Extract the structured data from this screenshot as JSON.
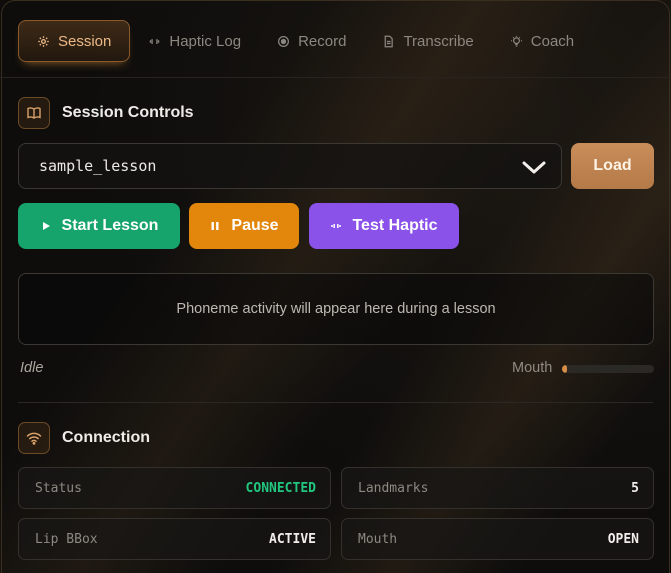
{
  "tabs": [
    {
      "label": "Session",
      "icon": "gear-icon",
      "active": true
    },
    {
      "label": "Haptic Log",
      "icon": "vibration-icon",
      "active": false
    },
    {
      "label": "Record",
      "icon": "record-icon",
      "active": false
    },
    {
      "label": "Transcribe",
      "icon": "document-icon",
      "active": false
    },
    {
      "label": "Coach",
      "icon": "lightbulb-icon",
      "active": false
    }
  ],
  "session_controls": {
    "title": "Session Controls",
    "icon": "book-icon",
    "lesson_select": {
      "value": "sample_lesson"
    },
    "load_label": "Load",
    "start_label": "Start Lesson",
    "pause_label": "Pause",
    "test_haptic_label": "Test Haptic",
    "phoneme_placeholder": "Phoneme activity will appear here during a lesson",
    "status_text": "Idle",
    "mouth_label": "Mouth",
    "mouth_level": 0.05
  },
  "connection": {
    "title": "Connection",
    "icon": "wifi-icon",
    "cards": [
      {
        "key": "Status",
        "value": "CONNECTED"
      },
      {
        "key": "Landmarks",
        "value": "5"
      },
      {
        "key": "Lip BBox",
        "value": "ACTIVE"
      },
      {
        "key": "Mouth",
        "value": "OPEN"
      }
    ]
  },
  "colors": {
    "accent": "#ecb987",
    "start": "#16a36c",
    "pause": "#e2860c",
    "haptic": "#8a52e8",
    "connected": "#22c77f",
    "load": "#c98d5a"
  }
}
